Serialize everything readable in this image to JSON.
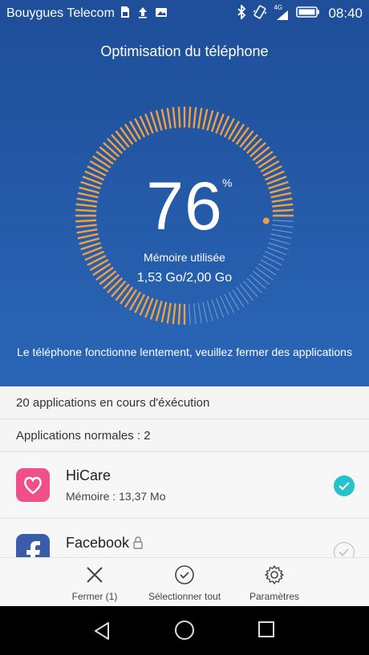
{
  "status_bar": {
    "carrier": "Bouygues Telecom",
    "network": "4G",
    "time": "08:40",
    "icons_left": [
      "sim-icon",
      "upload-icon",
      "photo-icon"
    ],
    "icons_right": [
      "bluetooth-icon",
      "vibrate-icon",
      "signal-icon",
      "battery-icon"
    ]
  },
  "hero": {
    "title": "Optimisation du téléphone",
    "percent_value": "76",
    "percent_sign": "%",
    "memory_label": "Mémoire utilisée",
    "memory_value": "1,53  Go/2,00  Go",
    "usage_fraction": 0.76,
    "message": "Le téléphone fonctionne lentement, veuillez fermer des applications",
    "colors": {
      "background": "#1f4f9a",
      "accent": "#f0a040",
      "track": "#6f95cc"
    }
  },
  "list": {
    "running_header": "20 applications en cours d'éxécution",
    "normal_header": "Applications normales : 2",
    "apps": [
      {
        "name": "HiCare",
        "memory": "Mémoire : 13,37  Mo",
        "checked": true,
        "icon": "heart-icon",
        "icon_color": "#f0508a"
      },
      {
        "name": "Facebook",
        "memory": "",
        "checked": false,
        "locked": true,
        "icon": "facebook-icon",
        "icon_color": "#3b5ca8"
      }
    ]
  },
  "actions": {
    "close": "Fermer (1)",
    "select_all": "Sélectionner tout",
    "settings": "Paramètres"
  },
  "nav": [
    "back-icon",
    "home-icon",
    "recents-icon"
  ]
}
